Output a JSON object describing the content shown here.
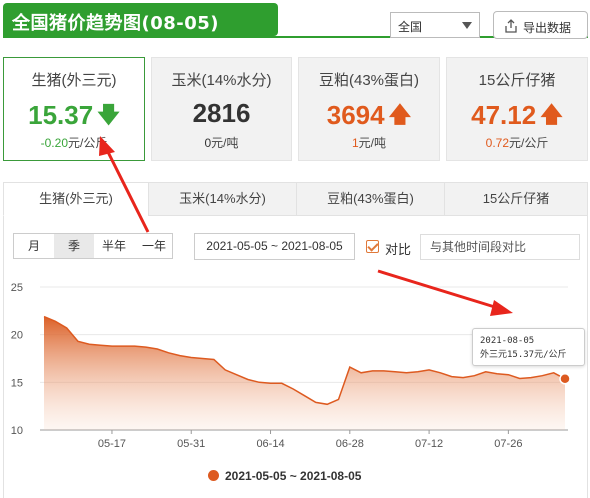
{
  "header": {
    "title": "全国猪价趋势图(08-05)"
  },
  "toolbar": {
    "region": "全国",
    "export_label": "导出数据"
  },
  "cards": [
    {
      "name": "生猪(外三元)",
      "value": "15.37",
      "direction": "down",
      "change": "-0.20",
      "unit": "元/公斤",
      "color": "#3aa53a"
    },
    {
      "name": "玉米(14%水分)",
      "value": "2816",
      "direction": "none",
      "change": "0",
      "unit": "元/吨",
      "color": "#333333"
    },
    {
      "name": "豆粕(43%蛋白)",
      "value": "3694",
      "direction": "up",
      "change": "1",
      "unit": "元/吨",
      "color": "#e05a1d"
    },
    {
      "name": "15公斤仔猪",
      "value": "47.12",
      "direction": "up",
      "change": "0.72",
      "unit": "元/公斤",
      "color": "#e05a1d"
    }
  ],
  "tabs": [
    "生猪(外三元)",
    "玉米(14%水分)",
    "豆粕(43%蛋白)",
    "15公斤仔猪"
  ],
  "controls": {
    "ranges": [
      "月",
      "季",
      "半年",
      "一年"
    ],
    "selected_range": "季",
    "date_range": "2021-05-05 ~ 2021-08-05",
    "compare_label": "对比",
    "compare_checked": true,
    "compare_placeholder": "与其他时间段对比"
  },
  "tooltip": {
    "date": "2021-08-05",
    "text": "外三元15.37元/公斤"
  },
  "chart_data": {
    "type": "area",
    "title": "",
    "xlabel": "",
    "ylabel": "",
    "ylim": [
      10,
      25
    ],
    "yticks": [
      10,
      15,
      20,
      25
    ],
    "xticks": [
      "05-17",
      "05-31",
      "06-14",
      "06-28",
      "07-12",
      "07-26"
    ],
    "x_start": "2021-05-05",
    "x_end": "2021-08-05",
    "grid": "horizontal",
    "legend_position": "bottom",
    "series": [
      {
        "name": "2021-05-05 ~ 2021-08-05",
        "color": "#dd5a20",
        "x": [
          "2021-05-05",
          "2021-05-07",
          "2021-05-09",
          "2021-05-11",
          "2021-05-13",
          "2021-05-15",
          "2021-05-17",
          "2021-05-19",
          "2021-05-21",
          "2021-05-23",
          "2021-05-25",
          "2021-05-27",
          "2021-05-29",
          "2021-05-31",
          "2021-06-02",
          "2021-06-04",
          "2021-06-06",
          "2021-06-08",
          "2021-06-10",
          "2021-06-12",
          "2021-06-14",
          "2021-06-16",
          "2021-06-18",
          "2021-06-20",
          "2021-06-22",
          "2021-06-24",
          "2021-06-26",
          "2021-06-28",
          "2021-06-30",
          "2021-07-02",
          "2021-07-04",
          "2021-07-06",
          "2021-07-08",
          "2021-07-10",
          "2021-07-12",
          "2021-07-14",
          "2021-07-16",
          "2021-07-18",
          "2021-07-20",
          "2021-07-22",
          "2021-07-24",
          "2021-07-26",
          "2021-07-28",
          "2021-07-30",
          "2021-08-01",
          "2021-08-03",
          "2021-08-05"
        ],
        "values": [
          21.9,
          21.4,
          20.7,
          19.3,
          19.0,
          18.9,
          18.8,
          18.8,
          18.8,
          18.7,
          18.5,
          18.1,
          17.8,
          17.6,
          17.5,
          17.4,
          16.3,
          15.8,
          15.3,
          15.0,
          14.9,
          14.9,
          14.3,
          13.6,
          12.9,
          12.7,
          13.2,
          16.6,
          16.0,
          16.2,
          16.2,
          16.1,
          16.0,
          16.1,
          16.3,
          16.0,
          15.6,
          15.5,
          15.7,
          16.1,
          15.9,
          15.8,
          15.4,
          15.5,
          15.7,
          16.0,
          15.37
        ]
      }
    ]
  }
}
